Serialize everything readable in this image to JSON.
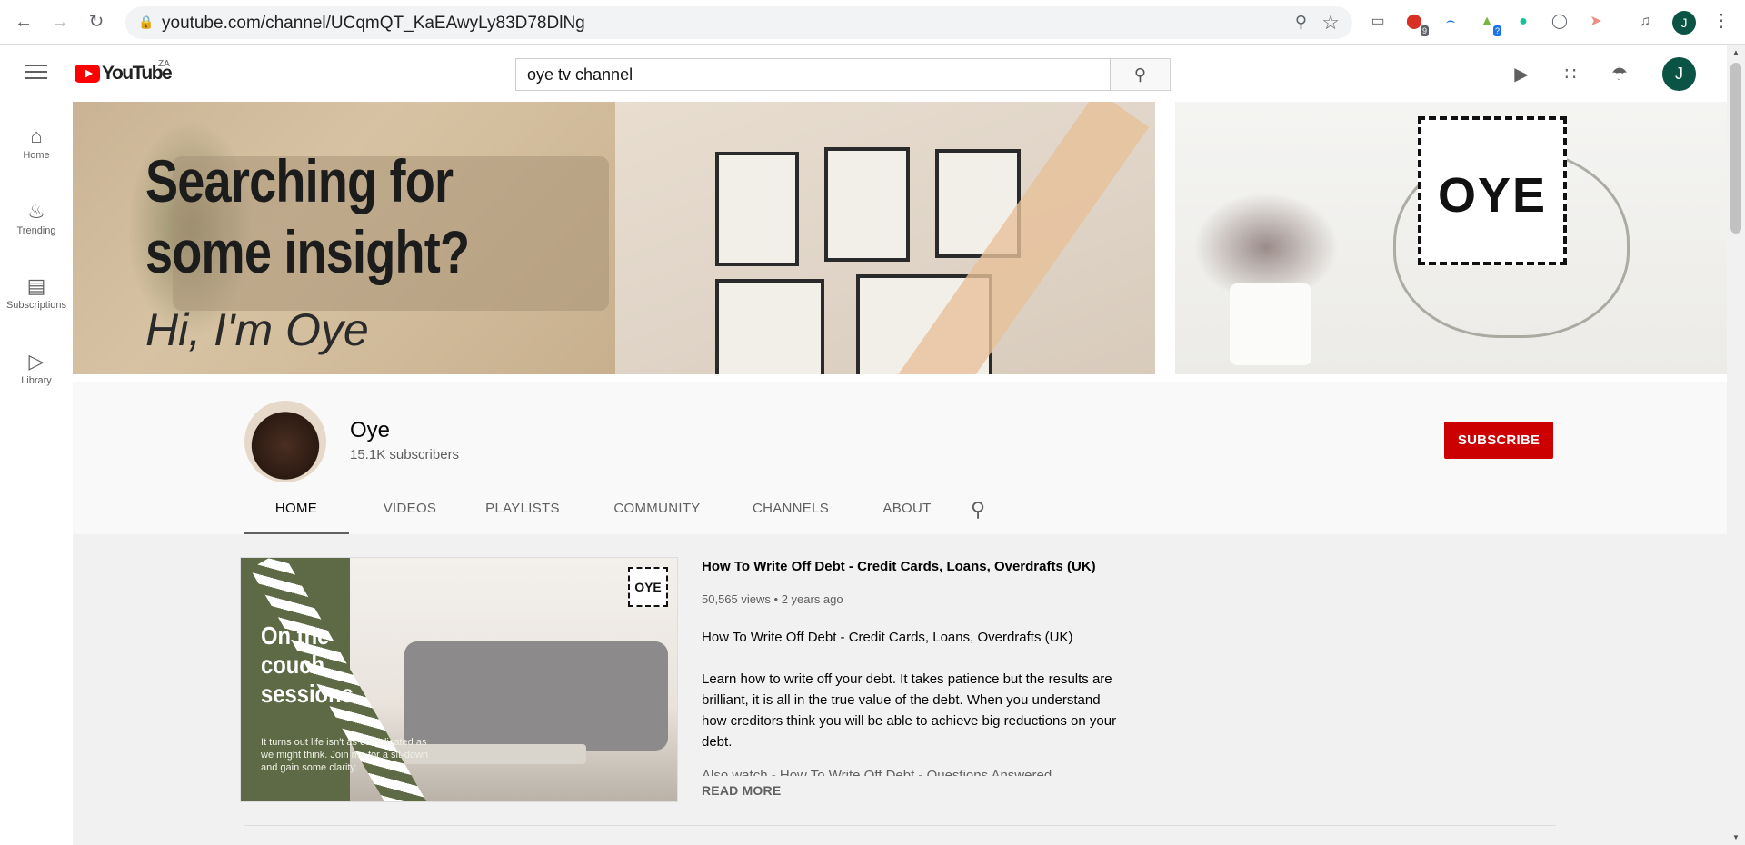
{
  "browser": {
    "url": "youtube.com/channel/UCqmQT_KaEAwyLy83D78DlNg",
    "profile_initial": "J",
    "ext_badge_1": "9",
    "ext_badge_2": "?"
  },
  "masthead": {
    "logo_text": "YouTube",
    "region": "ZA",
    "search_value": "oye tv channel",
    "avatar_initial": "J"
  },
  "guide": {
    "items": [
      {
        "label": "Home",
        "icon": "home-icon"
      },
      {
        "label": "Trending",
        "icon": "fire-icon"
      },
      {
        "label": "Subscriptions",
        "icon": "subscriptions-icon"
      },
      {
        "label": "Library",
        "icon": "library-icon"
      }
    ]
  },
  "banner": {
    "headline_1": "Searching for",
    "headline_2": "some insight?",
    "tagline": "Hi, I'm Oye",
    "logo_text": "OYE"
  },
  "channel": {
    "name": "Oye",
    "subscribers": "15.1K subscribers",
    "subscribe_label": "SUBSCRIBE",
    "tabs": [
      "HOME",
      "VIDEOS",
      "PLAYLISTS",
      "COMMUNITY",
      "CHANNELS",
      "ABOUT"
    ],
    "active_tab": "HOME"
  },
  "featured_video": {
    "title": "How To Write Off Debt - Credit Cards, Loans, Overdrafts (UK)",
    "views": "50,565 views",
    "age": "2 years ago",
    "desc_1": "How To Write Off Debt - Credit Cards, Loans, Overdrafts (UK)",
    "desc_2": "Learn how to write off your debt.  It takes patience but the results are brilliant, it is all in the true value of the debt.  When you understand how creditors think you will be able to achieve big reductions on your debt.",
    "desc_3": "Also watch - How To Write Off Debt - Questions Answered",
    "read_more": "READ MORE",
    "thumb_title_1": "On the",
    "thumb_title_2": "couch",
    "thumb_title_3": "sessions",
    "thumb_sub": "It turns out life isn't as complicated as we  might think. Join me for a sit-down and gain some clarity.",
    "thumb_logo": "OYE"
  },
  "colors": {
    "subscribe_red": "#cc0000",
    "youtube_red": "#ff0000",
    "avatar_green": "#0b5345"
  }
}
